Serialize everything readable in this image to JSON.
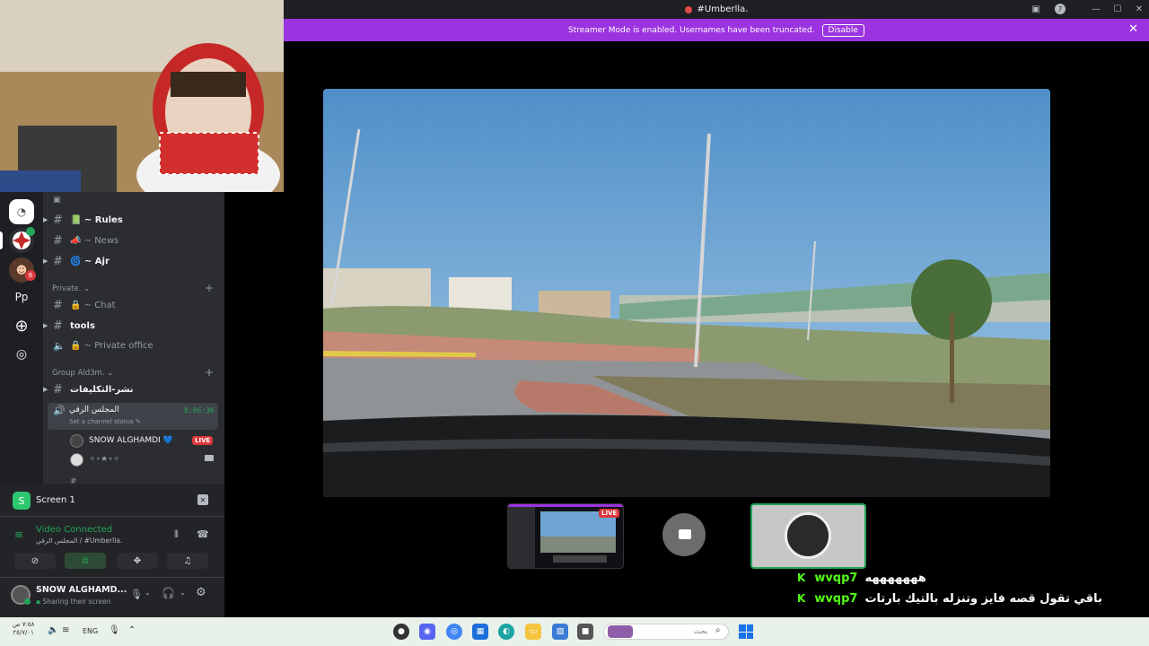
{
  "window": {
    "title": "#Umberlla."
  },
  "banner": {
    "text": "Streamer Mode is enabled. Usernames have been truncated.",
    "button": "Disable"
  },
  "rail": {
    "pp_label": "Pp",
    "badge_count": "6"
  },
  "channels": {
    "items": [
      {
        "label": "Rules",
        "icon": "📗"
      },
      {
        "label": "News",
        "icon": "📣"
      },
      {
        "label": "Ajr",
        "icon": "🌀"
      }
    ],
    "cat_private": "Private.",
    "private_items": [
      {
        "label": "Chat"
      },
      {
        "label": "tools"
      },
      {
        "label": "Private office"
      }
    ],
    "cat_group": "Group Ald3m.",
    "group_text": "نشر-التكليفات",
    "voice_name": "المجلس الرقي",
    "voice_timer": "8:06:36",
    "voice_status": "Set a channel status",
    "voice_users": [
      {
        "name": "SNOW ALGHAMDI 💙",
        "live": "LIVE"
      },
      {
        "name": "✧⋆★⋆✧"
      }
    ]
  },
  "screen_panel": {
    "title": "Screen 1",
    "rtc_status": "Video Connected",
    "rtc_channel": "المجلس الرقي / #Umberlla.",
    "user_name": "SNOW ALGHAMD...",
    "user_status": "Sharing their screen"
  },
  "stage": {
    "tile_live": "LIVE"
  },
  "chat": [
    {
      "user": "wvqp7",
      "message": "هههههههه"
    },
    {
      "user": "wvqp7",
      "message": "باقي تقول قصه فايز وتنزله بالتيك بارتات"
    }
  ],
  "taskbar": {
    "time": "٧:٥٨ ص",
    "date": "٢٥/٧/٠١",
    "lang": "ENG",
    "search_placeholder": "بحث"
  },
  "colors": {
    "accent": "#9b34e0",
    "live": "#da373c",
    "kick_green": "#53fc18",
    "connected": "#23a55a"
  }
}
